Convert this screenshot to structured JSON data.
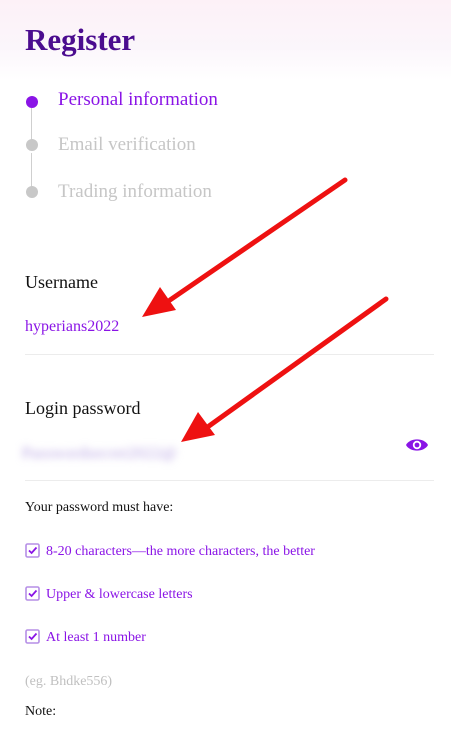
{
  "page": {
    "title": "Register"
  },
  "steps": [
    {
      "label": "Personal information",
      "state": "active"
    },
    {
      "label": "Email verification",
      "state": "inactive"
    },
    {
      "label": "Trading information",
      "state": "inactive"
    }
  ],
  "form": {
    "username": {
      "label": "Username",
      "value": "hyperians2022"
    },
    "password": {
      "label": "Login password",
      "value": "Passwordsecret2022@"
    }
  },
  "requirements": {
    "title": "Your password must have:",
    "items": [
      "8-20 characters—the more characters, the better",
      "Upper & lowercase letters",
      "At least 1 number"
    ],
    "example": "(eg. Bhdke556)",
    "note_label": "Note:"
  },
  "icons": {
    "password_visibility": "eye-icon",
    "requirement_check": "checkbox-checked-icon"
  },
  "colors": {
    "accent": "#8a14e6",
    "title": "#4b0c8f",
    "inactive": "#c6c6c6",
    "annotation": "#ee1111"
  }
}
